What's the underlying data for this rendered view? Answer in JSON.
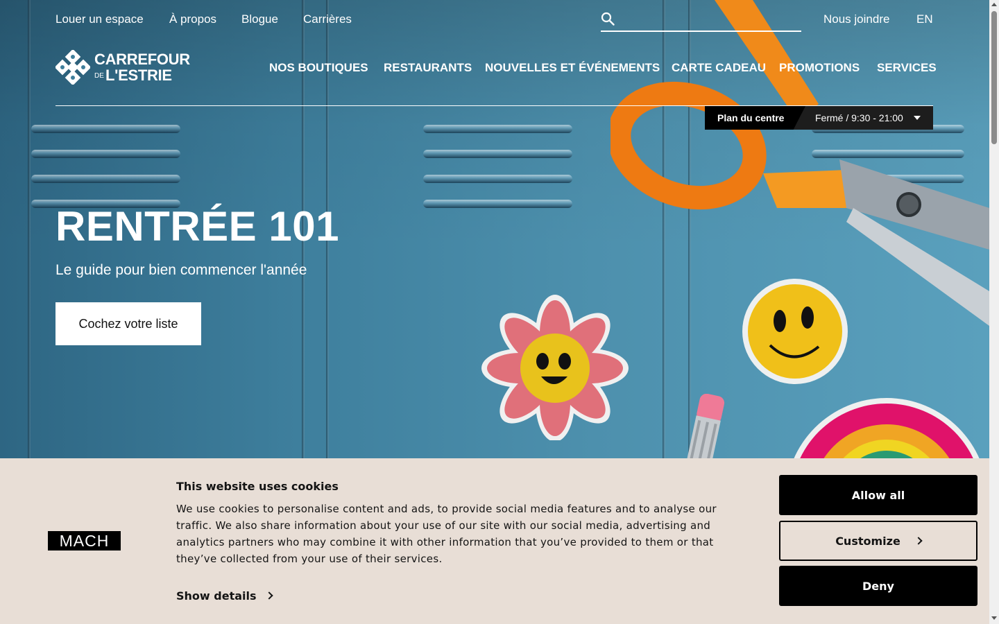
{
  "utility_nav": {
    "links": [
      "Louer un espace",
      "À propos",
      "Blogue",
      "Carrières"
    ],
    "contact": "Nous joindre",
    "language": "EN",
    "search": {
      "placeholder": "",
      "value": "",
      "icon": "search-icon"
    }
  },
  "logo": {
    "line1": "CARREFOUR",
    "de": "DE",
    "line2": "L'ESTRIE"
  },
  "main_nav": [
    "NOS BOUTIQUES",
    "RESTAURANTS",
    "NOUVELLES ET ÉVÉNEMENTS",
    "CARTE CADEAU",
    "PROMOTIONS",
    "SERVICES"
  ],
  "store_info": {
    "plan_label": "Plan du centre",
    "hours": "Fermé / 9:30 - 21:00"
  },
  "hero": {
    "title": "RENTRÉE 101",
    "subtitle": "Le guide pour bien commencer l'année",
    "cta": "Cochez votre liste"
  },
  "cookie_banner": {
    "logo_text": "MACH",
    "title": "This website uses cookies",
    "text": "We use cookies to personalise content and ads, to provide social media features and to analyse our traffic. We also share information about your use of our site with our social media, advertising and analytics partners who may combine it with other information that you’ve provided to them or that they’ve collected from your use of their services.",
    "show_details": "Show details",
    "buttons": {
      "allow_all": "Allow all",
      "customize": "Customize",
      "deny": "Deny"
    }
  },
  "colors": {
    "locker_blue": "#3f7f9c",
    "banner_bg": "#e8ded6",
    "button_black": "#000000"
  }
}
